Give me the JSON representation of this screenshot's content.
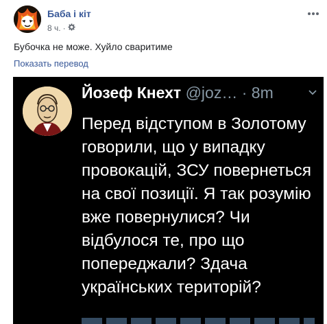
{
  "post": {
    "author": "Баба і кіт",
    "time": "8 ч.",
    "separator": "·",
    "privacy_icon": "gear-icon",
    "more_icon": "more-icon",
    "text": "Бубочка не може. Хуйло сваритиме",
    "translate_link": "Показать перевод"
  },
  "tweet": {
    "name": "Йозеф Кнехт",
    "handle": "@joz…",
    "separator": "·",
    "time": "8m",
    "body": "Перед відступом в Золотому говорили, що у випадку провокацій, ЗСУ повернеться на свої позиції. Я так розумію вже повернулися? Чи відбулося те, про що попереджали? Здача українських територій?"
  },
  "colors": {
    "link": "#385898",
    "tweet_bg": "#000000",
    "tweet_secondary": "#8899a6"
  }
}
